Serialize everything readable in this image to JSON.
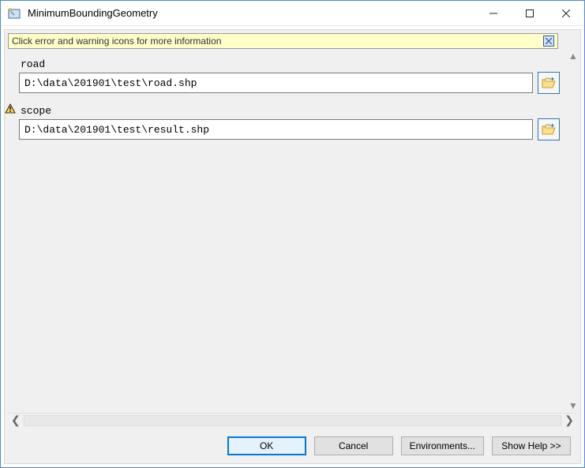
{
  "window": {
    "title": "MinimumBoundingGeometry"
  },
  "info_bar": {
    "text": "Click error and warning icons for more information"
  },
  "params": [
    {
      "name": "road",
      "value": "D:\\data\\201901\\test\\road.shp",
      "has_warning": false
    },
    {
      "name": "scope",
      "value": "D:\\data\\201901\\test\\result.shp",
      "has_warning": true
    }
  ],
  "buttons": {
    "ok": "OK",
    "cancel": "Cancel",
    "environments": "Environments...",
    "show_help": "Show Help >>"
  }
}
